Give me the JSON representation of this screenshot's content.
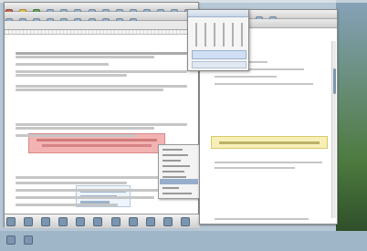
{
  "left_window": {
    "title": "",
    "heading": "",
    "context_menu_items": [
      "",
      "",
      "",
      "",
      "",
      "",
      "",
      ""
    ]
  },
  "right_window": {
    "title": ""
  },
  "popup": {
    "title": ""
  },
  "colors": {
    "note_bg": "#f3b3b3",
    "note_border": "#d98989",
    "highlight_bg": "#f6efb6",
    "toolbar": "#d0d0d0"
  }
}
